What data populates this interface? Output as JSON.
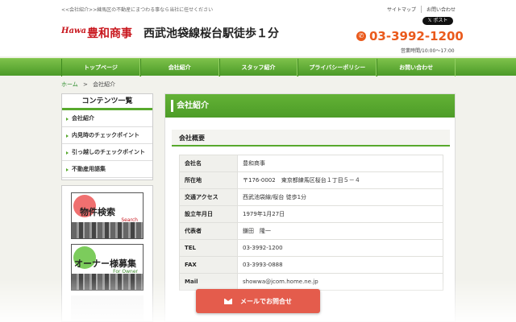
{
  "header": {
    "tagline": "<<会社紹介>>練馬区の不動産にまつわる事なら当社に任せください",
    "links": [
      "サイトマップ",
      "お問い合わせ"
    ],
    "post_button": "ポスト",
    "logo_mark": "Hawa",
    "logo_text": "豊和商事",
    "logo_sub": "西武池袋線桜台駅徒歩１分",
    "phone_icon": "phone-icon",
    "phone": "03-3992-1200",
    "hours": "営業時間/10:00～17:00"
  },
  "nav": {
    "items": [
      "トップページ",
      "会社紹介",
      "スタッフ紹介",
      "プライバシーポリシー",
      "お問い合わせ"
    ]
  },
  "breadcrumb": {
    "home": "ホーム",
    "separator": ">",
    "current": "会社紹介"
  },
  "sidebar": {
    "title": "コンテンツ一覧",
    "items": [
      "会社紹介",
      "内見時のチェックポイント",
      "引っ越しのチェックポイント",
      "不動産用語集"
    ],
    "banners": [
      {
        "title": "物件検索",
        "sub": "Search",
        "color": "#f07070"
      },
      {
        "title": "オーナー様募集",
        "sub": "For Owner",
        "color": "#7ccc5c"
      }
    ]
  },
  "main": {
    "heading": "会社紹介",
    "section": "会社概要",
    "rows": [
      {
        "key": "会社名",
        "value": "豊和商事"
      },
      {
        "key": "所在地",
        "value": "〒176-0002　東京都練馬区桜台１丁目５－４"
      },
      {
        "key": "交通アクセス",
        "value": "西武池袋線/桜台 徒歩1分"
      },
      {
        "key": "設立年月日",
        "value": "1979年1月27日"
      },
      {
        "key": "代表者",
        "value": "鎌田　隆一"
      },
      {
        "key": "TEL",
        "value": "03-3992-1200"
      },
      {
        "key": "FAX",
        "value": "03-3993-0888"
      },
      {
        "key": "Mail",
        "value": "showwa@jcom.home.ne.jp"
      }
    ]
  },
  "mail_button": {
    "label": "メールでお問合せ",
    "icon": "mail-icon"
  },
  "colors": {
    "green": "#58a92d",
    "brand_red": "#c8161d",
    "phone_orange": "#ea5a1c",
    "mail_button": "#e45c4c"
  }
}
